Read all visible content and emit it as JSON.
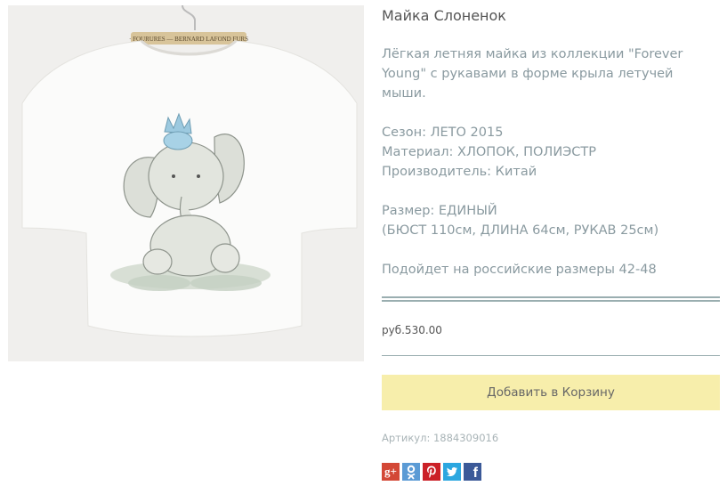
{
  "product": {
    "title": "Майка Слоненок",
    "description": "Лёгкая летняя майка из коллекции \"Forever Young\" с рукавами в форме крыла летучей мыши.",
    "season": "Сезон: ЛЕТО 2015",
    "material": "Материал: ХЛОПОК, ПОЛИЭСТР",
    "manufacturer": "Производитель: Китай",
    "size": "Размер: ЕДИНЫЙ",
    "dimensions": "(БЮСТ 110см, ДЛИНА 64см, РУКАВ 25см)",
    "fit": "Подойдет на российские размеры 42-48",
    "price": "руб.530.00",
    "add_to_cart_label": "Добавить в Корзину",
    "sku": "Артикул: 1884309016",
    "image_label": "· FOURURES — BERNARD LAFOND FURS"
  },
  "share": [
    {
      "name": "google-plus-icon",
      "color": "#d34836",
      "glyph": "g+"
    },
    {
      "name": "odnoklassniki-icon",
      "color": "#5b9bd5",
      "glyph": ""
    },
    {
      "name": "pinterest-icon",
      "color": "#cb2027",
      "glyph": ""
    },
    {
      "name": "twitter-icon",
      "color": "#2ca7e0",
      "glyph": ""
    },
    {
      "name": "facebook-icon",
      "color": "#3b5998",
      "glyph": "f"
    }
  ],
  "colors": {
    "cart_button": "#f7eeab",
    "divider": "#9aaeb0",
    "text_muted": "#8a9aa0"
  }
}
